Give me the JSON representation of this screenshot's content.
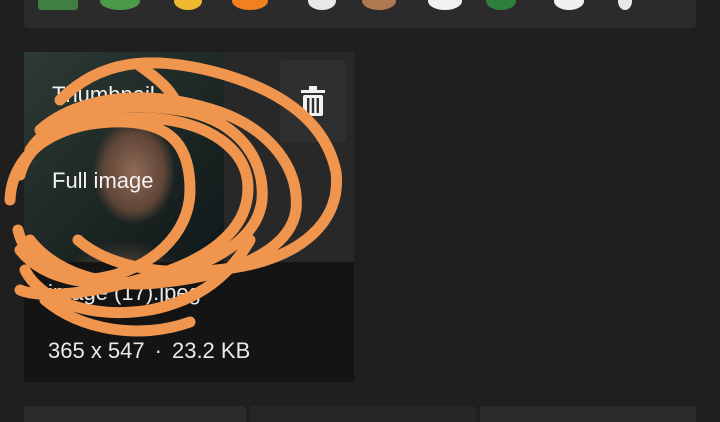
{
  "attachment": {
    "overlay_title": "Thumbnail",
    "overlay_sub": "Full image",
    "filename": "image (17).jpeg",
    "dimensions": "365 x 547",
    "separator": "·",
    "size": "23.2 KB",
    "delete_icon": "trash-icon"
  },
  "colors": {
    "background": "#1f1f1f",
    "card": "#282828",
    "meta_bg": "#141414",
    "annotation": "#f0954e"
  }
}
